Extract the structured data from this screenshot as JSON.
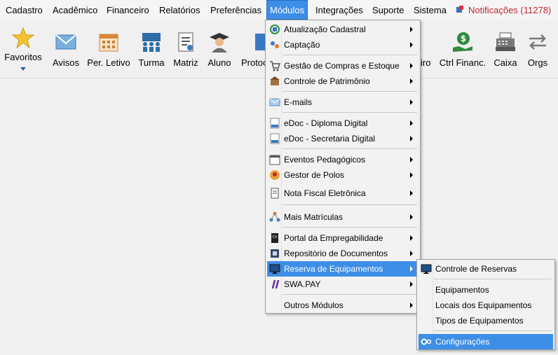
{
  "menubar": {
    "items": [
      "Cadastro",
      "Acadêmico",
      "Financeiro",
      "Relatórios",
      "Preferências",
      "Módulos",
      "Integrações",
      "Suporte",
      "Sistema"
    ],
    "notifications": "Notificações (11278)"
  },
  "toolbar": {
    "favoritos": "Favoritos",
    "avisos": "Avisos",
    "periodo": "Per. Letivo",
    "turma": "Turma",
    "matriz": "Matriz",
    "aluno": "Aluno",
    "protocolo": "Protoc",
    "financeiro": "iro",
    "ctrl_financ": "Ctrl Financ.",
    "caixa": "Caixa",
    "orgs": "Orgs"
  },
  "modulos_menu": {
    "items": [
      "Atualização Cadastral",
      "Captação",
      "Gestão de Compras e Estoque",
      "Controle de Patrimônio",
      "E-mails",
      "eDoc - Diploma Digital",
      "eDoc - Secretaria Digital",
      "Eventos Pedagógicos",
      "Gestor de Polos",
      "Nota Fiscal Eletrônica",
      "Mais Matrículas",
      "Portal da Empregabilidade",
      "Repositório de Documentos",
      "Reserva de Equipamentos",
      "SWA.PAY",
      "Outros Módulos"
    ]
  },
  "reserva_submenu": {
    "items": [
      "Controle de Reservas",
      "Equipamentos",
      "Locais dos Equipamentos",
      "Tipos de Equipamentos",
      "Configurações"
    ]
  },
  "colors": {
    "highlight": "#3d8ee6",
    "notification": "#c0282e"
  }
}
